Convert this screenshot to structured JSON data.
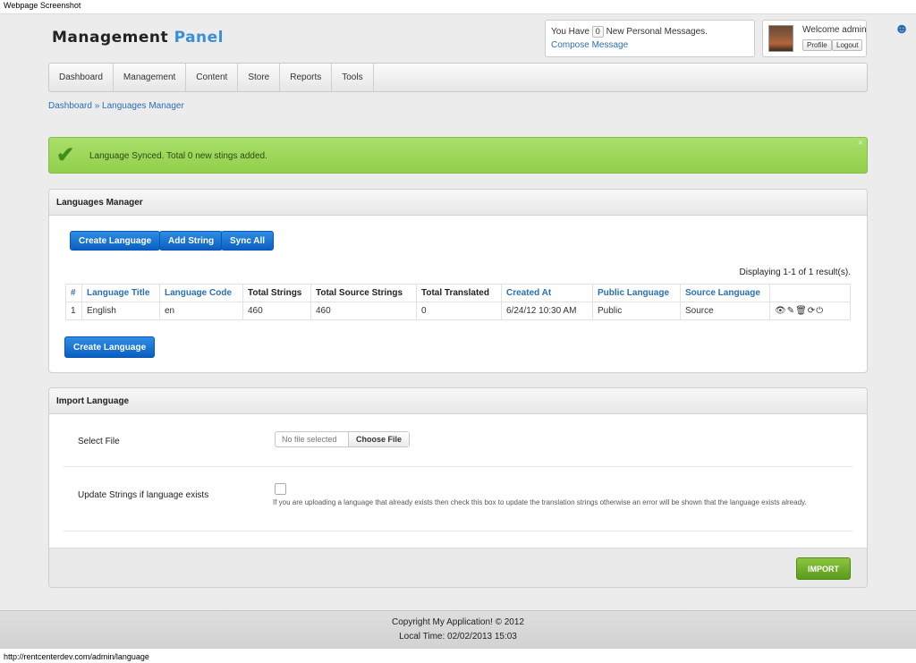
{
  "window": {
    "title": "Webpage Screenshot",
    "status_url": "http://rentcenterdev.com/admin/language"
  },
  "logo": {
    "part1": "Management ",
    "part2": "Panel"
  },
  "messages": {
    "prefix": "You Have",
    "count": "0",
    "suffix": "New Personal Messages.",
    "compose": "Compose Message"
  },
  "user": {
    "welcome": "Welcome admin",
    "profile": "Profile",
    "logout": "Logout"
  },
  "nav": [
    "Dashboard",
    "Management",
    "Content",
    "Store",
    "Reports",
    "Tools"
  ],
  "breadcrumb": {
    "home": "Dashboard",
    "sep": " » ",
    "current": "Languages Manager"
  },
  "alert": {
    "message": "Language Synced. Total 0 new stings added.",
    "close": "×"
  },
  "languages_panel": {
    "title": "Languages Manager",
    "buttons": {
      "create": "Create Language",
      "add_string": "Add String",
      "sync_all": "Sync All"
    },
    "displaying": "Displaying 1-1 of 1 result(s).",
    "columns": [
      "#",
      "Language Title",
      "Language Code",
      "Total Strings",
      "Total Source Strings",
      "Total Translated",
      "Created At",
      "Public Language",
      "Source Language",
      ""
    ],
    "rows": [
      [
        "1",
        "English",
        "en",
        "460",
        "460",
        "0",
        "6/24/12 10:30 AM",
        "Public",
        "Source"
      ]
    ],
    "create_bottom": "Create Language"
  },
  "import_panel": {
    "title": "Import Language",
    "select_file_label": "Select File",
    "no_file": "No file selected",
    "choose_file": "Choose File",
    "update_label": "Update Strings if language exists",
    "help": "If you are uploading a language that already exists then check this box to update the translation strings otherwise an error will be shown that the language exists already.",
    "import_button": "IMPORT"
  },
  "footer": {
    "copyright": "Copyright My Application! © 2012",
    "local_time": "Local Time: 02/02/2013 15:03"
  },
  "colors": {
    "accent": "#3a8fd6",
    "alert_bg": "#a9df6a",
    "primary_button": "#0a5fc2",
    "import_button": "#6aaa26"
  }
}
